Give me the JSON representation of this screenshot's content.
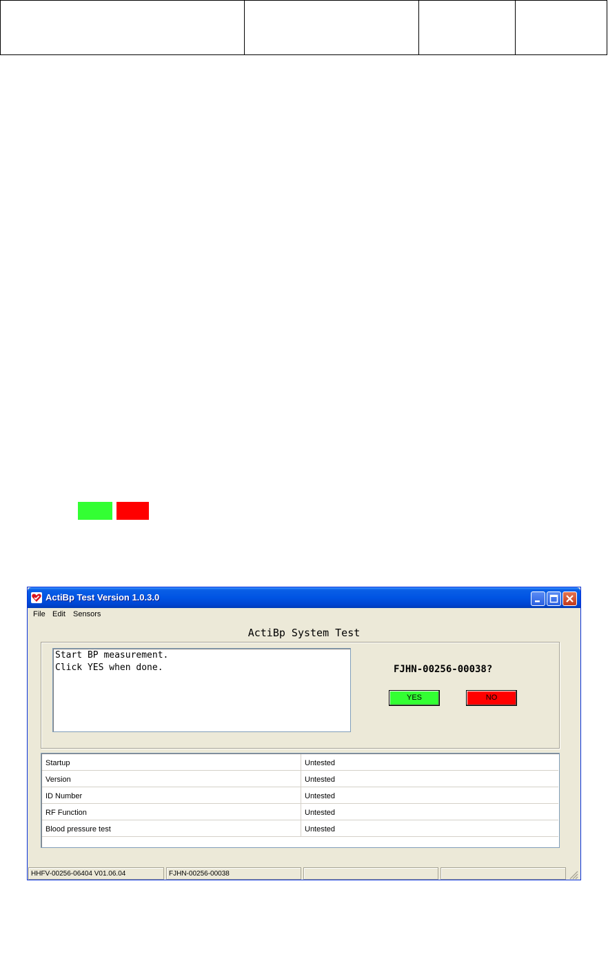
{
  "window": {
    "title": "ActiBp Test Version 1.0.3.0"
  },
  "menu": {
    "items": [
      "File",
      "Edit",
      "Sensors"
    ]
  },
  "main": {
    "system_title": "ActiBp System Test",
    "message": "Start BP measurement.\nClick YES when done.",
    "serial_prompt": "FJHN-00256-00038?",
    "yes_label": "YES",
    "no_label": "NO"
  },
  "tests": [
    {
      "name": "Startup",
      "status": "Untested"
    },
    {
      "name": "Version",
      "status": "Untested"
    },
    {
      "name": "ID Number",
      "status": "Untested"
    },
    {
      "name": "RF Function",
      "status": "Untested"
    },
    {
      "name": "Blood pressure test",
      "status": "Untested"
    }
  ],
  "statusbar": {
    "pane1": "HHFV-00256-06404 V01.06.04",
    "pane2": "FJHN-00256-00038",
    "pane3": "",
    "pane4": ""
  },
  "colors": {
    "yes": "#33ff33",
    "no": "#ff0000",
    "titlebar": "#0054e3"
  }
}
